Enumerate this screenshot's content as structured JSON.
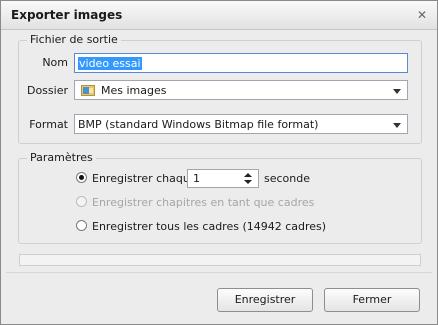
{
  "window": {
    "title": "Exporter images",
    "close_glyph": "✕"
  },
  "output_group": {
    "legend": "Fichier de sortie",
    "name_label": "Nom",
    "name_value": "video essai",
    "folder_label": "Dossier",
    "folder_value": "Mes images",
    "folder_icon": "folder-images-icon",
    "format_label": "Format",
    "format_value": "BMP (standard Windows Bitmap file format)"
  },
  "params_group": {
    "legend": "Paramètres",
    "options": [
      {
        "label": "Enregistrer chaque",
        "selected": true,
        "disabled": false
      },
      {
        "label": "Enregistrer chapitres en tant que cadres",
        "selected": false,
        "disabled": true
      },
      {
        "label": "Enregistrer tous les cadres (14942 cadres)",
        "selected": false,
        "disabled": false
      }
    ],
    "interval_value": "1",
    "interval_unit": "seconde"
  },
  "progress": {
    "value": 0
  },
  "buttons": {
    "save": "Enregistrer",
    "close": "Fermer"
  }
}
